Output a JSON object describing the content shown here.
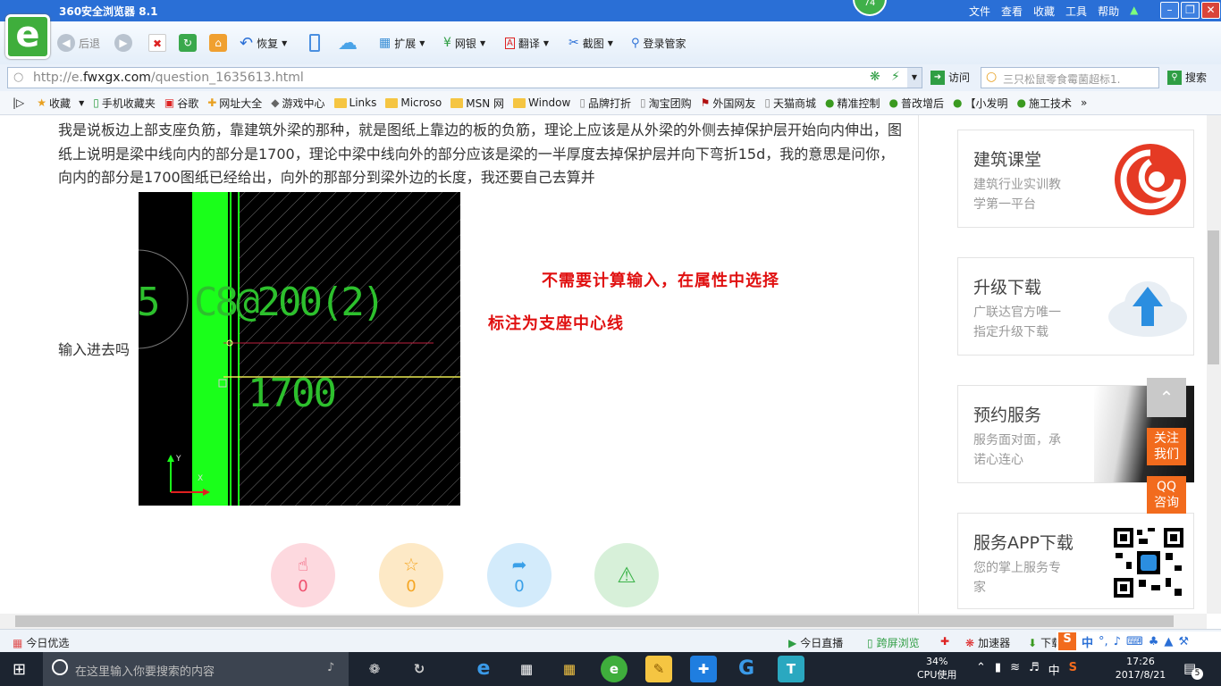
{
  "browser": {
    "title": "360安全浏览器 8.1",
    "badge": "74",
    "menu": [
      "文件",
      "查看",
      "收藏",
      "工具",
      "帮助"
    ],
    "toolbar": {
      "back": "后退",
      "restore": "恢复",
      "extensions": "扩展",
      "bank": "网银",
      "translate": "翻译",
      "screenshot": "截图",
      "login_manager": "登录管家"
    },
    "address": {
      "url_prefix": "http://e.",
      "url_domain": "fwxgx.com",
      "url_path": "/question_1635613.html",
      "go": "访问",
      "search_placeholder": "三只松鼠零食霉菌超标1.",
      "search_button": "搜索"
    },
    "bookmarks": [
      "收藏",
      "手机收藏夹",
      "谷歌",
      "网址大全",
      "游戏中心",
      "Links",
      "Microso",
      "MSN 网",
      "Window",
      "品牌打折",
      "淘宝团购",
      "外国网友",
      "天猫商城",
      "精准控制",
      "普改增后",
      "【小发明",
      "施工技术"
    ]
  },
  "content": {
    "paragraph": "我是说板边上部支座负筋，靠建筑外梁的那种，就是图纸上靠边的板的负筋，理论上应该是从外梁的外侧去掉保护层开始向内伸出，图纸上说明是梁中线向内的部分是1700，理论中梁中线向外的部分应该是梁的一半厚度去掉保护层并向下弯折15d，我的意思是问你，向内的部分是1700图纸已经给出，向外的那部分到梁外边的长度，我还要自己去算并",
    "paragraph_end": "输入进去吗",
    "cad": {
      "left_digit": "5",
      "rebar_label": "C8@200(2)",
      "dimension": "1700",
      "axis_y": "Y",
      "axis_x": "X"
    },
    "note1": "不需要计算输入，在属性中选择",
    "note2": "标注为支座中心线",
    "actions": [
      {
        "icon": "thumbs-up",
        "count": "0",
        "color": "#f0506e"
      },
      {
        "icon": "star",
        "count": "0",
        "color": "#f5a623"
      },
      {
        "icon": "share",
        "count": "0",
        "color": "#3aa0e8"
      },
      {
        "icon": "warning",
        "count": "",
        "color": "#3cb34a"
      }
    ]
  },
  "sidebar": {
    "cards": [
      {
        "title": "建筑课堂",
        "desc1": "建筑行业实训教",
        "desc2": "学第一平台"
      },
      {
        "title": "升级下载",
        "desc1": "广联达官方唯一",
        "desc2": "指定升级下载"
      },
      {
        "title": "预约服务",
        "desc1": "服务面对面，承",
        "desc2": "诺心连心"
      },
      {
        "title": "服务APP下载",
        "desc1": "您的掌上服务专",
        "desc2": "家"
      }
    ],
    "follow": "关注我们",
    "follow1": "关注",
    "follow2": "我们",
    "qq1": "QQ",
    "qq2": "咨询"
  },
  "statusbar": {
    "left": "今日优选",
    "live": "今日直播",
    "cross": "跨屏浏览",
    "accel": "加速器",
    "download": "下载",
    "ime": "中"
  },
  "taskbar": {
    "search_placeholder": "在这里输入你要搜索的内容",
    "cpu_percent": "34%",
    "cpu_label": "CPU使用",
    "ime": "中",
    "time": "17:26",
    "date": "2017/8/21",
    "notifications": "5"
  },
  "colors": {
    "accent": "#2a6fd6",
    "cad_green": "#1aff1a",
    "note_red": "#e01010",
    "orange": "#f26b1d"
  }
}
